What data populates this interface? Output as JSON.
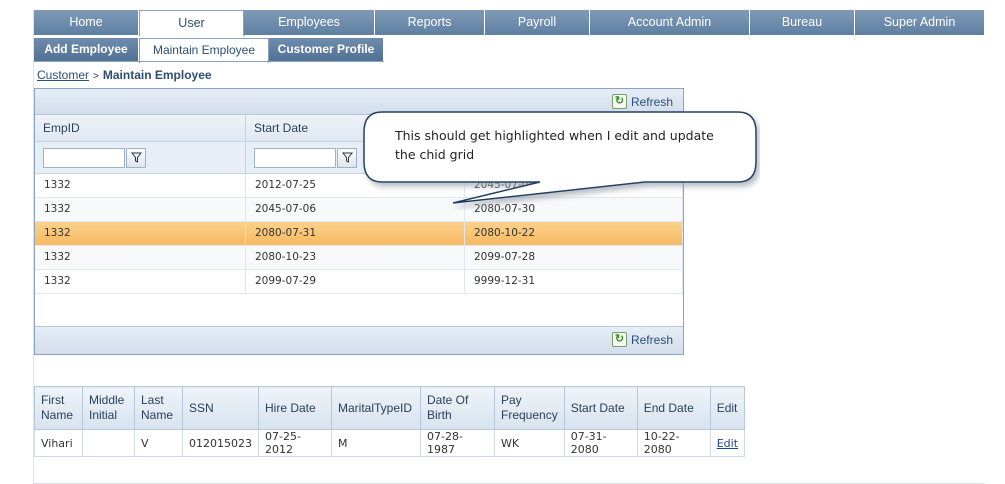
{
  "main_nav": [
    "Home",
    "User",
    "Employees",
    "Reports",
    "Payroll",
    "Account Admin",
    "Bureau",
    "Super Admin"
  ],
  "main_nav_active": "User",
  "sub_nav": [
    "Add Employee",
    "Maintain Employee",
    "Customer Profile"
  ],
  "sub_nav_active": "Maintain Employee",
  "breadcrumb": {
    "link": "Customer",
    "separator": ">",
    "current": "Maintain Employee"
  },
  "grid": {
    "refresh_label": "Refresh",
    "columns": [
      "EmpID",
      "Start Date",
      ""
    ],
    "rows": [
      [
        "1332",
        "2012-07-25",
        "2045-07-05"
      ],
      [
        "1332",
        "2045-07-06",
        "2080-07-30"
      ],
      [
        "1332",
        "2080-07-31",
        "2080-10-22"
      ],
      [
        "1332",
        "2080-10-23",
        "2099-07-28"
      ],
      [
        "1332",
        "2099-07-29",
        "9999-12-31"
      ]
    ],
    "selected_row_index": 2
  },
  "callout": {
    "text": "This should get highlighted when I  edit and update the chid grid"
  },
  "detail": {
    "columns": [
      "First Name",
      "Middle Initial",
      "Last Name",
      "SSN",
      "Hire Date",
      "MaritalTypeID",
      "Date Of Birth",
      "Pay Frequency",
      "Start Date",
      "End Date",
      "Edit"
    ],
    "row": [
      "Vihari",
      "",
      "V",
      "012015023",
      "07-25-2012",
      "M",
      "07-28-1987",
      "WK",
      "07-31-2080",
      "10-22-2080",
      "Edit"
    ]
  },
  "colors": {
    "nav": "#6f8cad",
    "selected_row": "#f7b960",
    "border": "#8aa3bf",
    "link": "#2a4f7a"
  }
}
